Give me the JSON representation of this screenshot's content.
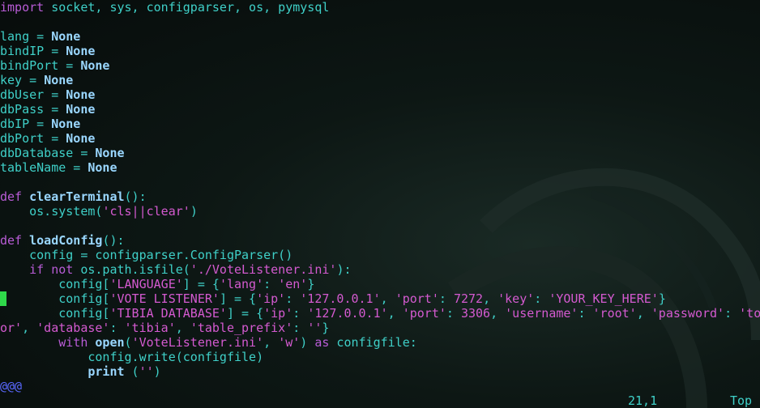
{
  "colors": {
    "text": "#3fd0c8",
    "keyword": "#b85cd6",
    "constant": "#9ad7ff",
    "string": "#d45ad0",
    "cursor": "#2fd84a",
    "tilde": "#5a68ff"
  },
  "code_lines": [
    [
      [
        "kw",
        "import"
      ],
      [
        "t",
        " socket, sys, configparser, os, pymysql"
      ]
    ],
    [],
    [
      [
        "t",
        "lang = "
      ],
      [
        "const",
        "None"
      ]
    ],
    [
      [
        "t",
        "bindIP = "
      ],
      [
        "const",
        "None"
      ]
    ],
    [
      [
        "t",
        "bindPort = "
      ],
      [
        "const",
        "None"
      ]
    ],
    [
      [
        "t",
        "key = "
      ],
      [
        "const",
        "None"
      ]
    ],
    [
      [
        "t",
        "dbUser = "
      ],
      [
        "const",
        "None"
      ]
    ],
    [
      [
        "t",
        "dbPass = "
      ],
      [
        "const",
        "None"
      ]
    ],
    [
      [
        "t",
        "dbIP = "
      ],
      [
        "const",
        "None"
      ]
    ],
    [
      [
        "t",
        "dbPort = "
      ],
      [
        "const",
        "None"
      ]
    ],
    [
      [
        "t",
        "dbDatabase = "
      ],
      [
        "const",
        "None"
      ]
    ],
    [
      [
        "t",
        "tableName = "
      ],
      [
        "const",
        "None"
      ]
    ],
    [],
    [
      [
        "kw",
        "def "
      ],
      [
        "fn",
        "clearTerminal"
      ],
      [
        "t",
        "():"
      ]
    ],
    [
      [
        "t",
        "    os.system("
      ],
      [
        "str",
        "'cls||clear'"
      ],
      [
        "t",
        ")"
      ]
    ],
    [],
    [
      [
        "kw",
        "def "
      ],
      [
        "fn",
        "loadConfig"
      ],
      [
        "t",
        "():"
      ]
    ],
    [
      [
        "t",
        "    config = configparser.ConfigParser()"
      ]
    ],
    [
      [
        "t",
        "    "
      ],
      [
        "kw",
        "if not"
      ],
      [
        "t",
        " os.path.isfile("
      ],
      [
        "str",
        "'./VoteListener.ini'"
      ],
      [
        "t",
        "):"
      ]
    ],
    [
      [
        "t",
        "        config["
      ],
      [
        "str",
        "'LANGUAGE'"
      ],
      [
        "t",
        "] = {"
      ],
      [
        "str",
        "'lang'"
      ],
      [
        "t",
        ": "
      ],
      [
        "str",
        "'en'"
      ],
      [
        "t",
        "}"
      ]
    ],
    [
      [
        "t",
        "        config["
      ],
      [
        "str",
        "'VOTE LISTENER'"
      ],
      [
        "t",
        "] = {"
      ],
      [
        "str",
        "'ip'"
      ],
      [
        "t",
        ": "
      ],
      [
        "str",
        "'127.0.0.1'"
      ],
      [
        "t",
        ", "
      ],
      [
        "str",
        "'port'"
      ],
      [
        "t",
        ": "
      ],
      [
        "num",
        "7272"
      ],
      [
        "t",
        ", "
      ],
      [
        "str",
        "'key'"
      ],
      [
        "t",
        ": "
      ],
      [
        "str",
        "'YOUR_KEY_HERE'"
      ],
      [
        "t",
        "}"
      ]
    ],
    [
      [
        "t",
        "        config["
      ],
      [
        "str",
        "'TIBIA DATABASE'"
      ],
      [
        "t",
        "] = {"
      ],
      [
        "str",
        "'ip'"
      ],
      [
        "t",
        ": "
      ],
      [
        "str",
        "'127.0.0.1'"
      ],
      [
        "t",
        ", "
      ],
      [
        "str",
        "'port'"
      ],
      [
        "t",
        ": "
      ],
      [
        "num",
        "3306"
      ],
      [
        "t",
        ", "
      ],
      [
        "str",
        "'username'"
      ],
      [
        "t",
        ": "
      ],
      [
        "str",
        "'root'"
      ],
      [
        "t",
        ", "
      ],
      [
        "str",
        "'password'"
      ],
      [
        "t",
        ": "
      ],
      [
        "str",
        "'to"
      ]
    ],
    [
      [
        "str",
        "or'"
      ],
      [
        "t",
        ", "
      ],
      [
        "str",
        "'database'"
      ],
      [
        "t",
        ": "
      ],
      [
        "str",
        "'tibia'"
      ],
      [
        "t",
        ", "
      ],
      [
        "str",
        "'table_prefix'"
      ],
      [
        "t",
        ": "
      ],
      [
        "str",
        "''"
      ],
      [
        "t",
        "}"
      ]
    ],
    [
      [
        "t",
        "        "
      ],
      [
        "kw",
        "with "
      ],
      [
        "fn",
        "open"
      ],
      [
        "t",
        "("
      ],
      [
        "str",
        "'VoteListener.ini'"
      ],
      [
        "t",
        ", "
      ],
      [
        "str",
        "'w'"
      ],
      [
        "t",
        ") "
      ],
      [
        "kw",
        "as"
      ],
      [
        "t",
        " configfile:"
      ]
    ],
    [
      [
        "t",
        "            config.write(configfile)"
      ]
    ],
    [
      [
        "t",
        "            "
      ],
      [
        "fn",
        "print"
      ],
      [
        "t",
        " ("
      ],
      [
        "str",
        "''"
      ],
      [
        "t",
        ")"
      ]
    ]
  ],
  "tilde_marker": "@@@",
  "status": {
    "position": "21,1",
    "scroll": "Top"
  }
}
